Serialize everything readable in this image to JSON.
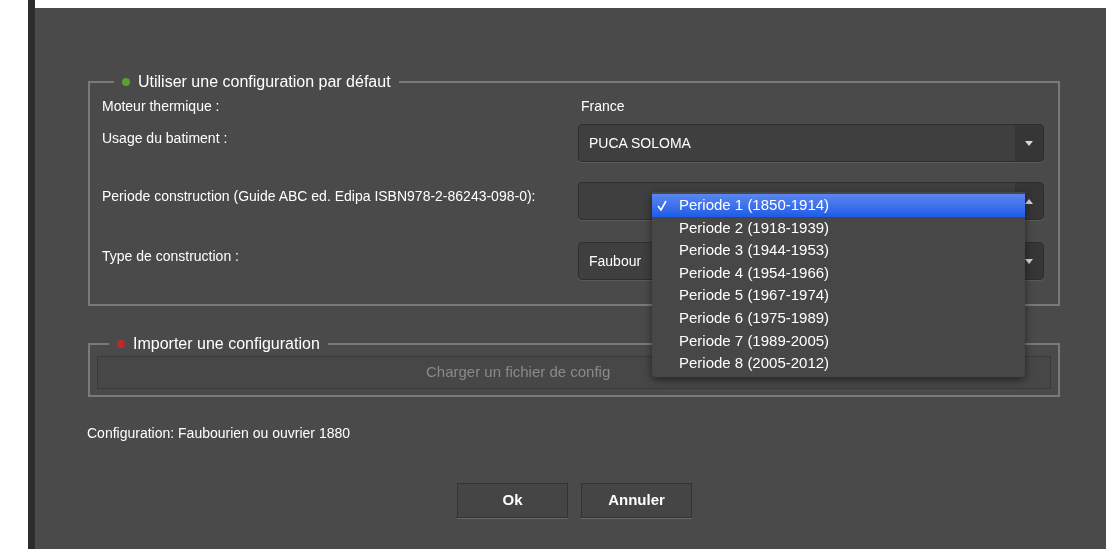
{
  "default_group": {
    "title": "Utiliser une configuration par défaut",
    "color": "#5aa02c",
    "rows": [
      {
        "kind": "text",
        "label": "Moteur thermique :",
        "value": "France"
      },
      {
        "kind": "select",
        "label": "Usage du batiment :",
        "value": "PUCA SOLOMA",
        "open": false
      },
      {
        "kind": "select",
        "label": "Periode construction (Guide ABC ed. Edipa ISBN978-2-86243-098-0):",
        "open": true
      },
      {
        "kind": "select",
        "label": "Type de construction :",
        "value": "Faubour",
        "open": false
      }
    ]
  },
  "dropdown": {
    "options": [
      {
        "label": "Periode 1 (1850-1914)",
        "selected": true
      },
      {
        "label": "Periode 2 (1918-1939)",
        "selected": false
      },
      {
        "label": "Periode 3 (1944-1953)",
        "selected": false
      },
      {
        "label": "Periode 4 (1954-1966)",
        "selected": false
      },
      {
        "label": "Periode 5 (1967-1974)",
        "selected": false
      },
      {
        "label": "Periode 6 (1975-1989)",
        "selected": false
      },
      {
        "label": "Periode 7 (1989-2005)",
        "selected": false
      },
      {
        "label": "Periode 8 (2005-2012)",
        "selected": false
      }
    ]
  },
  "import_group": {
    "title": "Importer une configuration",
    "color": "#c0282a",
    "load_button": {
      "label": "Charger un fichier de config",
      "disabled": true
    }
  },
  "configuration_text": "Configuration: Faubourien ou ouvrier 1880",
  "buttons": [
    "Ok",
    "Annuler"
  ]
}
